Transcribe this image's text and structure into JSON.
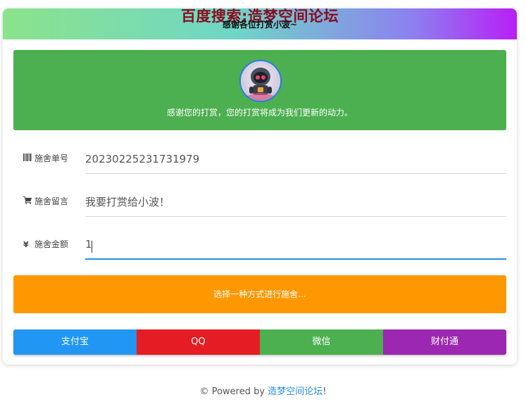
{
  "header": {
    "title": "百度搜索:造梦空间论坛",
    "subtitle": "感谢各位打赏小波~"
  },
  "banner": {
    "message": "感谢您的打赏，您的打赏将成为我们更新的动力。",
    "avatar_icon": "robot-astronaut-avatar"
  },
  "form": {
    "order": {
      "icon": "barcode-icon",
      "label": "施舍单号",
      "value": "20230225231731979"
    },
    "message": {
      "icon": "cart-icon",
      "label": "施舍留言",
      "value": "我要打赏给小波！"
    },
    "amount": {
      "icon": "yen-icon",
      "label": "施舍金额",
      "value": "1"
    }
  },
  "submit_label": "选择一种方式进行施舍...",
  "payment_methods": [
    {
      "label": "支付宝",
      "color": "#2196f3"
    },
    {
      "label": "QQ",
      "color": "#e51c23"
    },
    {
      "label": "微信",
      "color": "#4caf50"
    },
    {
      "label": "财付通",
      "color": "#9c27b0"
    }
  ],
  "footer": {
    "prefix": "© Powered by ",
    "link_text": "造梦空间论坛",
    "suffix": "!"
  }
}
